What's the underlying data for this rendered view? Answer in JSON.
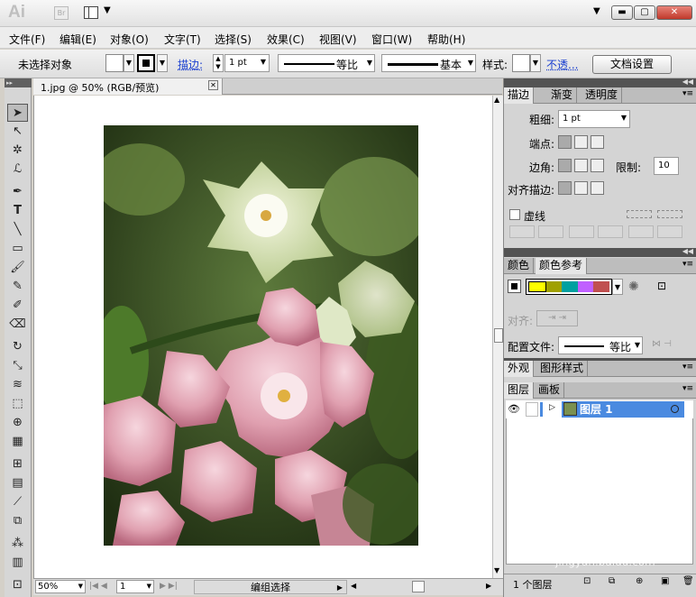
{
  "app": {
    "logo": "Ai",
    "bridge": "Br"
  },
  "menu": [
    "文件(F)",
    "编辑(E)",
    "对象(O)",
    "文字(T)",
    "选择(S)",
    "效果(C)",
    "视图(V)",
    "窗口(W)",
    "帮助(H)"
  ],
  "control": {
    "selection": "未选择对象",
    "stroke_label": "描边:",
    "stroke_weight": "1 pt",
    "profile_label": "等比",
    "brush_label": "基本",
    "style_label": "样式:",
    "opacity_link": "不透...",
    "doc_setup": "文档设置"
  },
  "document": {
    "tab_title": "1.jpg @ 50% (RGB/预览)"
  },
  "status": {
    "zoom": "50%",
    "page": "1",
    "status_text": "编组选择"
  },
  "stroke_panel": {
    "tabs": [
      "描边",
      "渐变",
      "透明度"
    ],
    "weight_label": "粗细:",
    "weight_value": "1 pt",
    "cap_label": "端点:",
    "corner_label": "边角:",
    "limit_label": "限制:",
    "limit_value": "10",
    "align_label": "对齐描边:",
    "dashed_label": "虚线"
  },
  "color_panel": {
    "tabs": [
      "颜色",
      "颜色参考"
    ],
    "guide_colors": [
      "#ffff00",
      "#a0a000",
      "#00a0a0",
      "#c060ff",
      "#c05050"
    ],
    "align_label": "对齐:",
    "profile_label": "配置文件:",
    "profile_value": "等比"
  },
  "appearance_tabs": [
    "外观",
    "图形样式"
  ],
  "layers_panel": {
    "tabs": [
      "图层",
      "画板"
    ],
    "layer_name": "图层 1",
    "count": "1 个图层"
  },
  "watermark": {
    "brand": "Baidu经验",
    "url": "jingyan.baidu.com"
  }
}
